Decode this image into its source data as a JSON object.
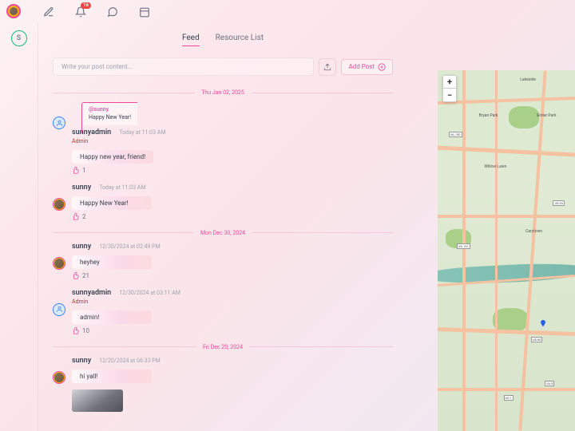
{
  "topbar": {
    "notification_count": "16"
  },
  "rail": {
    "avatar_letter": "S"
  },
  "tabs": {
    "feed": "Feed",
    "resources": "Resource List"
  },
  "composer": {
    "placeholder": "Write your post content...",
    "add_post": "Add Post"
  },
  "dates": {
    "d1": "Thu Jan 02, 2025",
    "d2": "Mon Dec 30, 2024",
    "d3": "Fri Dec 20, 2024"
  },
  "posts": [
    {
      "quote": {
        "handle": "@sunny",
        "text": "Happy New Year!"
      },
      "username": "sunnyadmin",
      "timestamp": "Today at 11:03 AM",
      "admin": "Admin",
      "content": "Happy new year, friend!",
      "likes": "1"
    },
    {
      "username": "sunny",
      "timestamp": "Today at 11:03 AM",
      "content": "Happy New Year!",
      "likes": "2"
    },
    {
      "username": "sunny",
      "timestamp": "12/30/2024 at 02:49 PM",
      "content": "heyhey",
      "likes": "21"
    },
    {
      "username": "sunnyadmin",
      "timestamp": "12/30/2024 at 03:11 AM",
      "admin": "Admin",
      "content": "admin!",
      "likes": "10"
    },
    {
      "username": "sunny",
      "timestamp": "12/20/2024 at 06:33 PM",
      "content": "hi yall!"
    }
  ],
  "map": {
    "zoom_in": "+",
    "zoom_out": "−",
    "places": {
      "lakeside": "Lakeside",
      "willow": "Willow Lawn",
      "bryan": "Bryan Park",
      "ginter": "Ginter Park",
      "carytown": "Carytown"
    },
    "routes": {
      "va150": "VA 150",
      "va161": "VA 161",
      "us1": "US 1",
      "us33": "US 33",
      "us60": "US 60",
      "va5": "VA 5"
    }
  }
}
